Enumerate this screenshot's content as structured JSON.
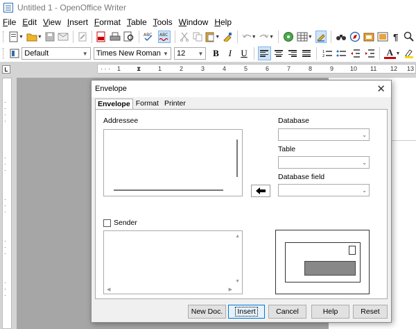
{
  "window": {
    "title": "Untitled 1 - OpenOffice Writer"
  },
  "menu": [
    "File",
    "Edit",
    "View",
    "Insert",
    "Format",
    "Table",
    "Tools",
    "Window",
    "Help"
  ],
  "formatting": {
    "style": "Default",
    "font": "Times New Roman",
    "size": "12",
    "bold": "B",
    "italic": "I",
    "underline": "U",
    "font_color_letter": "A"
  },
  "ruler": {
    "h_ticks": [
      "1",
      "1",
      "2",
      "3",
      "4",
      "5",
      "6",
      "7",
      "8",
      "9",
      "10",
      "11",
      "12",
      "13"
    ]
  },
  "dialog": {
    "title": "Envelope",
    "tabs": [
      "Envelope",
      "Format",
      "Printer"
    ],
    "addressee_label": "Addressee",
    "database_label": "Database",
    "table_label": "Table",
    "database_field_label": "Database field",
    "sender_label": "Sender",
    "buttons": {
      "new_doc": "New Doc.",
      "insert": "Insert",
      "cancel": "Cancel",
      "help": "Help",
      "reset": "Reset"
    }
  },
  "colors": {
    "accent": "#0078d7",
    "active_button_bg": "#cde4f7"
  }
}
